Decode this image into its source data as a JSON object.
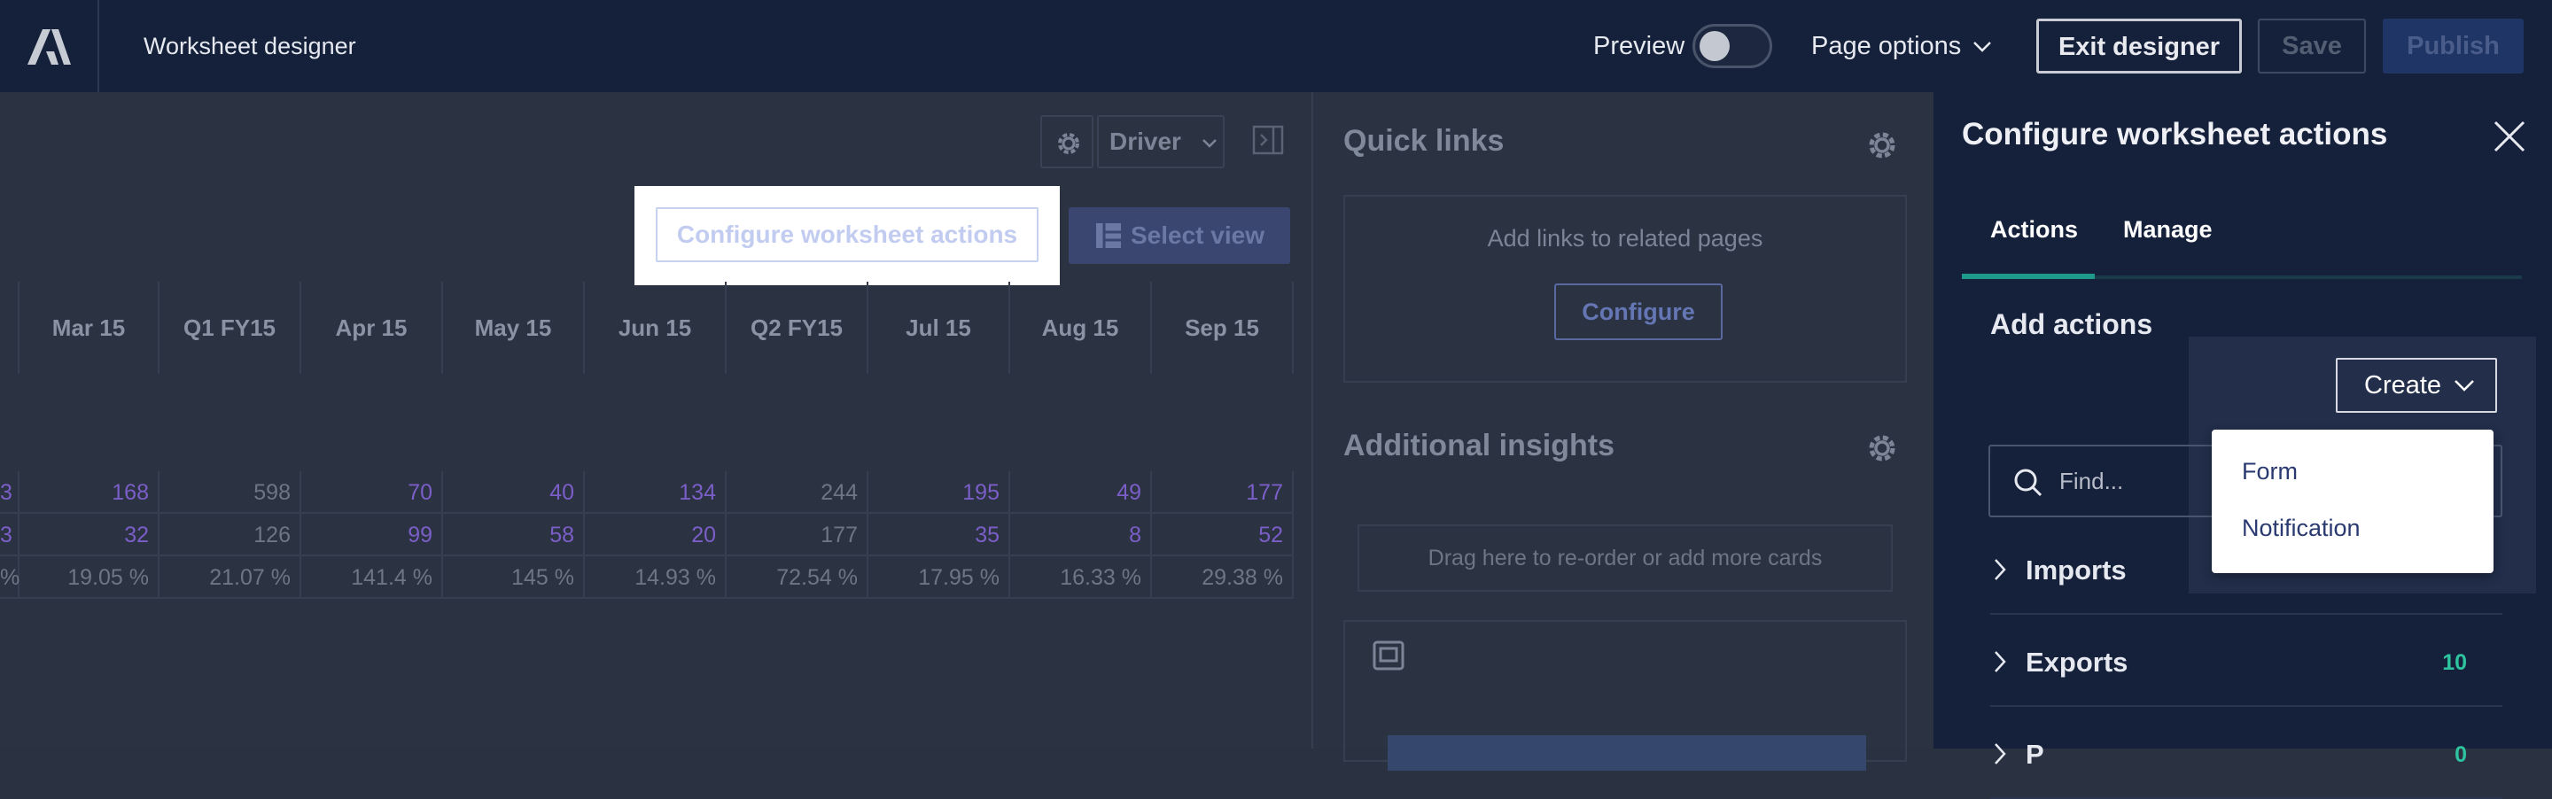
{
  "topbar": {
    "title": "Worksheet designer",
    "preview_label": "Preview",
    "preview_on": false,
    "page_options_label": "Page options",
    "exit_label": "Exit designer",
    "save_label": "Save",
    "publish_label": "Publish"
  },
  "worksheet": {
    "driver_label": "Driver",
    "configure_actions_label": "Configure worksheet actions",
    "select_view_label": "Select view",
    "columns": [
      "Mar 15",
      "Q1 FY15",
      "Apr 15",
      "May 15",
      "Jun 15",
      "Q2 FY15",
      "Jul 15",
      "Aug 15",
      "Sep 15"
    ],
    "rows": [
      [
        "3",
        "168",
        "598",
        "70",
        "40",
        "134",
        "244",
        "195",
        "49",
        "177"
      ],
      [
        "3",
        "32",
        "126",
        "99",
        "58",
        "20",
        "177",
        "35",
        "8",
        "52"
      ],
      [
        "%",
        "19.05 %",
        "21.07 %",
        "141.4 %",
        "145 %",
        "14.93 %",
        "72.54 %",
        "17.95 %",
        "16.33 %",
        "29.38 %"
      ]
    ]
  },
  "quick_links": {
    "title": "Quick links",
    "text": "Add links to related pages",
    "configure_label": "Configure"
  },
  "insights": {
    "title": "Additional insights",
    "drag_text": "Drag here to re-order or add more cards"
  },
  "side_panel": {
    "title": "Configure worksheet actions",
    "tabs": [
      {
        "label": "Actions"
      },
      {
        "label": "Manage"
      }
    ],
    "subtitle": "Add actions",
    "create_label": "Create",
    "find_placeholder": "Find...",
    "groups": [
      {
        "label": "Imports",
        "count": ""
      },
      {
        "label": "Exports",
        "count": "10"
      },
      {
        "label": "P",
        "count": "0"
      }
    ]
  },
  "create_menu": {
    "items": [
      {
        "label": "Form"
      },
      {
        "label": "Notification"
      }
    ]
  },
  "colors": {
    "topbar_bg": "#15203a",
    "accent_teal": "#1e9a8a",
    "count_green": "#2ec4a0",
    "link_purple": "#7b5ec8"
  }
}
